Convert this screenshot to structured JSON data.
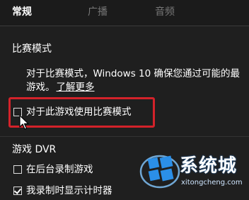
{
  "tabs": [
    {
      "label": "常规",
      "active": true
    },
    {
      "label": "广播",
      "active": false
    },
    {
      "label": "音频",
      "active": false
    }
  ],
  "game_mode": {
    "title": "比赛模式",
    "description_line1": "对于比赛模式，Windows 10 确保您通过可能的最",
    "description_line2": "游戏。",
    "learn_more": "了解更多",
    "checkbox_label": "对于此游戏使用比赛模式",
    "checkbox_checked": false
  },
  "game_dvr": {
    "title": "游戏 DVR",
    "options": [
      {
        "label": "在后台录制游戏",
        "checked": false
      },
      {
        "label": "我录制时显示计时器",
        "checked": true
      }
    ]
  },
  "watermark": {
    "text": "系统城",
    "url": "xitongcheng.com"
  },
  "colors": {
    "background": "#1f1f1f",
    "highlight": "#d3222a",
    "logo_blue": "#1e88e5"
  }
}
